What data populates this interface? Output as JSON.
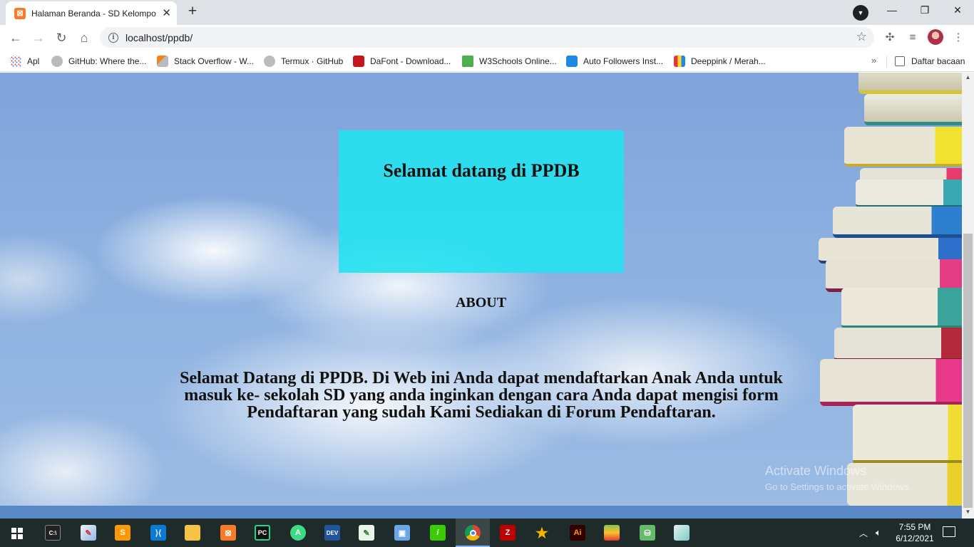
{
  "browser": {
    "tab": {
      "title": "Halaman Beranda - SD Kelompok",
      "favicon": "xampp-icon"
    },
    "address": {
      "url": "localhost/ppdb/"
    },
    "bookmarks": [
      {
        "label": "Apl",
        "icon": "apps-grid-icon"
      },
      {
        "label": "GitHub: Where the...",
        "icon": "github-icon"
      },
      {
        "label": "Stack Overflow - W...",
        "icon": "stackoverflow-icon"
      },
      {
        "label": "Termux · GitHub",
        "icon": "github-icon"
      },
      {
        "label": "DaFont - Download...",
        "icon": "dafont-icon"
      },
      {
        "label": "W3Schools Online...",
        "icon": "w3schools-icon"
      },
      {
        "label": "Auto Followers Inst...",
        "icon": "cube-icon"
      },
      {
        "label": "Deeppink / Merah...",
        "icon": "color-book-icon"
      }
    ],
    "reading_list": "Daftar bacaan"
  },
  "page": {
    "welcome_title": "Selamat datang di PPDB",
    "about_heading": "ABOUT",
    "about_lines": [
      "Selamat Datang di PPDB. Di Web ini Anda dapat mendaftarkan Anak Anda untuk",
      "masuk ke- sekolah SD yang anda inginkan dengan cara Anda dapat mengisi form",
      "Pendaftaran yang sudah Kami Sediakan di Forum Pendaftaran."
    ],
    "colors": {
      "welcome_box": "#24e2f0",
      "sky": "#8cb0e0"
    }
  },
  "watermark": {
    "line1": "Activate Windows",
    "line2": "Go to Settings to activate Windows."
  },
  "taskbar": {
    "apps": [
      "terminal-icon",
      "paint-icon",
      "sublime-icon",
      "vscode-icon",
      "file-explorer-icon",
      "xampp-icon",
      "pycharm-icon",
      "android-studio-icon",
      "devcpp-icon",
      "notepad-icon",
      "virtualbox-icon",
      "line-icon",
      "chrome-icon",
      "filezilla-icon",
      "star-icon",
      "illustrator-icon",
      "bluestacks-icon",
      "android-icon",
      "app-icon"
    ],
    "time": "7:55 PM",
    "date": "6/12/2021"
  }
}
